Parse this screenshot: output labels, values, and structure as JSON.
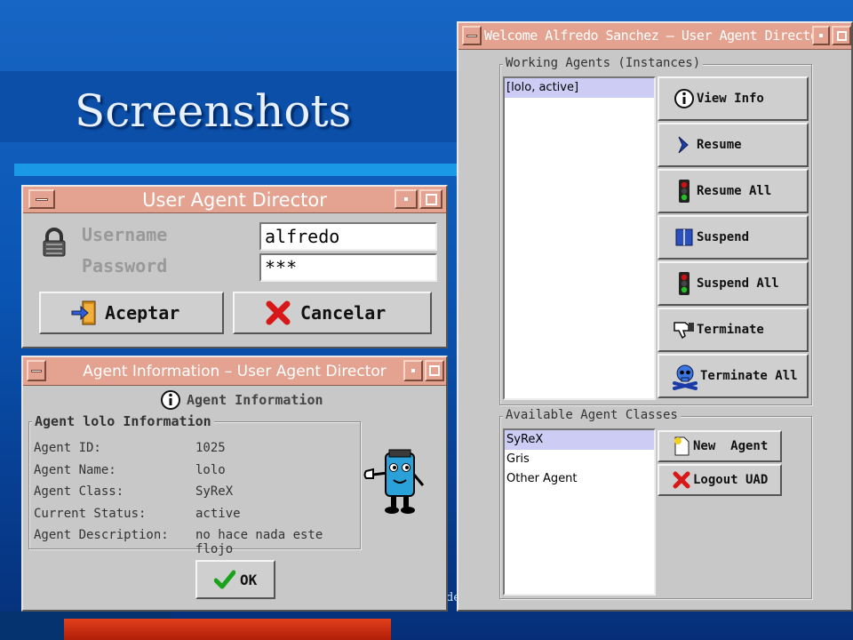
{
  "slide": {
    "title": "Screenshots",
    "footer_fragment": "de"
  },
  "login_window": {
    "title": "User Agent Director",
    "username_label": "Username",
    "password_label": "Password",
    "username_value": "alfredo",
    "password_value": "***",
    "accept_label": "Aceptar",
    "cancel_label": "Cancelar"
  },
  "info_window": {
    "title": "Agent Information – User Agent Director",
    "header": "Agent Information",
    "group_label": "Agent lolo Information",
    "rows": [
      {
        "key": "Agent ID:",
        "value": "1025"
      },
      {
        "key": "Agent Name:",
        "value": "lolo"
      },
      {
        "key": "Agent Class:",
        "value": "SyReX"
      },
      {
        "key": "Current Status:",
        "value": "active"
      },
      {
        "key": "Agent Description:",
        "value": "no hace nada este flojo"
      }
    ],
    "ok_label": "OK"
  },
  "director_window": {
    "title": "Welcome Alfredo Sanchez – User Agent Director",
    "working_group_label": "Working Agents (Instances)",
    "working_agents": [
      "[lolo, active]"
    ],
    "buttons": {
      "view_info": "View Info",
      "resume": "Resume",
      "resume_all": "Resume All",
      "suspend": "Suspend",
      "suspend_all": "Suspend All",
      "terminate": "Terminate",
      "terminate_all": "Terminate All"
    },
    "classes_group_label": "Available Agent Classes",
    "agent_classes": [
      "SyReX",
      "Gris",
      "Other Agent"
    ],
    "new_agent_label": "New  Agent",
    "logout_label": "Logout UAD"
  },
  "colors": {
    "titlebar": "#e4a390",
    "window_bg": "#c8c8c8",
    "selection": "#ccccf5"
  }
}
